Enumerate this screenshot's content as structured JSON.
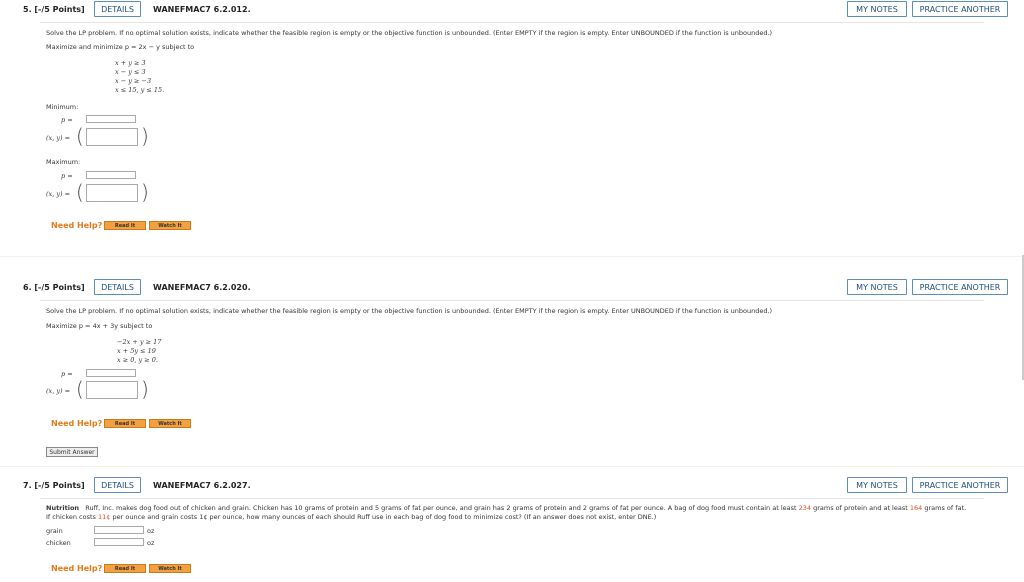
{
  "common": {
    "details": "DETAILS",
    "my_notes": "MY NOTES",
    "practice": "PRACTICE ANOTHER",
    "need_help": "Need Help?",
    "read_it": "Read It",
    "watch_it": "Watch It",
    "instructions": "Solve the LP problem. If no optimal solution exists, indicate whether the feasible region is empty or the objective function is unbounded. (Enter EMPTY if the region is empty. Enter UNBOUNDED if the function is unbounded.)"
  },
  "q5": {
    "num": "5. [-/5 Points]",
    "code": "WANEFMAC7 6.2.012.",
    "objective": "Maximize and minimize p = 2x − y subject to",
    "constraints": [
      "x + y ≥ 3",
      "x − y ≤ 3",
      "x − y ≥ −3",
      "x ≤ 15, y ≤ 15."
    ],
    "min_label": "Minimum:",
    "max_label": "Maximum:",
    "p_label": "p =",
    "xy_label": "(x, y) ="
  },
  "q6": {
    "num": "6. [-/5 Points]",
    "code": "WANEFMAC7 6.2.020.",
    "objective": "Maximize p = 4x + 3y subject to",
    "constraints": [
      "−2x + y ≥ 17",
      "x + 5y ≤ 19",
      "x ≥ 0, y ≥ 0."
    ],
    "p_label": "p =",
    "xy_label": "(x, y) =",
    "submit": "Submit Answer"
  },
  "q7": {
    "num": "7. [-/5 Points]",
    "code": "WANEFMAC7 6.2.027.",
    "lead": "Nutrition",
    "text1_a": "Ruff, Inc. makes dog food out of chicken and grain. Chicken has 10 grams of protein and 5 grams of fat per ounce, and grain has 2 grams of protein and 2 grams of fat per ounce. A bag of dog food must contain at least ",
    "text1_r1": "234",
    "text1_b": " grams of protein and at least ",
    "text1_r2": "164",
    "text1_c": " grams of fat.",
    "text2_a": "If chicken costs ",
    "text2_r1": "11¢",
    "text2_b": " per ounce and grain costs 1¢ per ounce, how many ounces of each should Ruff use in each bag of dog food to minimize cost? (If an answer does not exist, enter DNE.)",
    "grain_label": "grain",
    "chicken_label": "chicken",
    "oz": "oz"
  }
}
